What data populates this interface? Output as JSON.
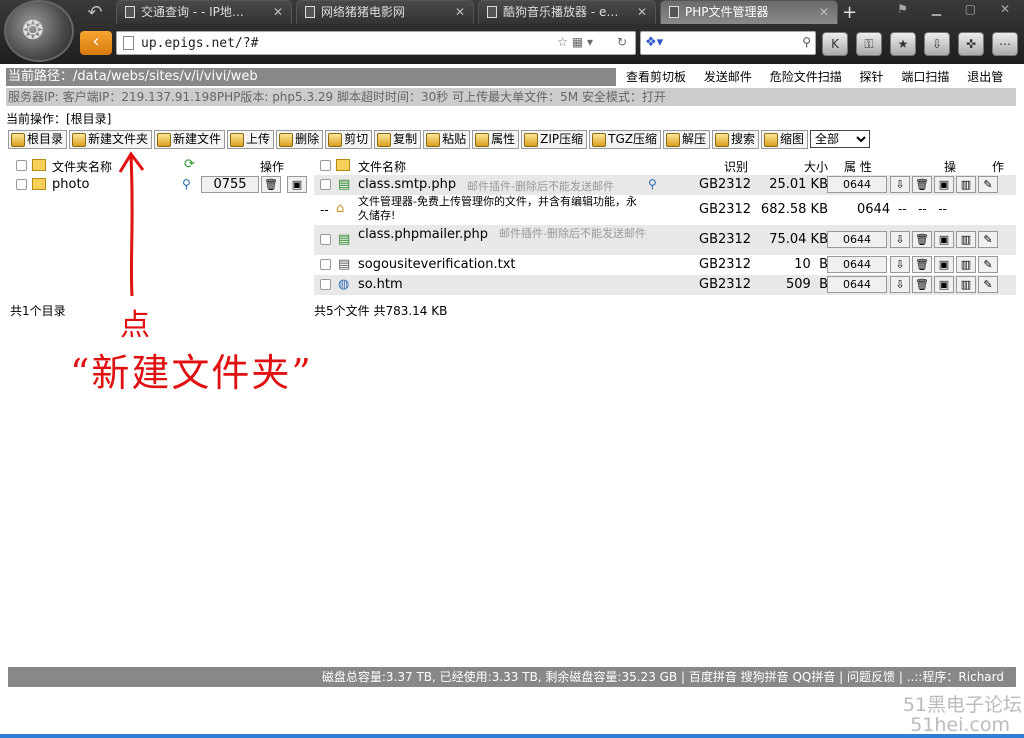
{
  "browser": {
    "tabs": [
      {
        "label": "交通查询 - - IP地…"
      },
      {
        "label": "网络猪猪电影网"
      },
      {
        "label": "酷狗音乐播放器 - e…"
      },
      {
        "label": "PHP文件管理器"
      }
    ],
    "url": "up.epigs.net/?#",
    "accent": "#f08c1c"
  },
  "path": {
    "label": "当前路径：/data/webs/sites/v/i/vivi/web"
  },
  "topmenu": [
    "查看剪切板",
    "发送邮件",
    "危险文件扫描",
    "探针",
    "端口扫描",
    "退出管理"
  ],
  "info": "服务器IP: 客户端IP：219.137.91.198PHP版本: php5.3.29 脚本超时时间：30秒 可上传最大单文件：5M 安全模式：打开",
  "current_op": "当前操作：[根目录]",
  "toolbar": {
    "items": [
      "根目录",
      "新建文件夹",
      "新建文件",
      "上传",
      "删除",
      "剪切",
      "复制",
      "粘贴",
      "属性",
      "ZIP压缩",
      "TGZ压缩",
      "解压",
      "搜索",
      "缩图"
    ],
    "select_value": "全部"
  },
  "dirs": {
    "header_name": "文件夹名称",
    "header_op": "操作",
    "rows": [
      {
        "name": "photo",
        "perm": "0755"
      }
    ],
    "count": "共1个目录"
  },
  "files": {
    "header_name": "文件名称",
    "header_enc": "识别",
    "header_size": "大小",
    "header_attr": "属 性",
    "header_op1": "操",
    "header_op2": "作",
    "rows": [
      {
        "name": "class.smtp.php",
        "desc": "邮件插件-删除后不能发送邮件",
        "enc": "GB2312",
        "size": "25.01 KB",
        "perm": "0644"
      },
      {
        "name": "文件管理器-免费上传管理你的文件，并含有编辑功能，永久储存!",
        "desc": "",
        "enc": "GB2312",
        "size": "682.58 KB",
        "perm": "0644",
        "mark": "--",
        "tail": "--   --   --"
      },
      {
        "name": "class.phpmailer.php",
        "desc": "邮件插件-删除后不能发送邮件",
        "enc": "GB2312",
        "size": "75.04 KB",
        "perm": "0644"
      },
      {
        "name": "sogousiteverification.txt",
        "desc": "",
        "enc": "GB2312",
        "size": "10  B",
        "perm": "0644"
      },
      {
        "name": "so.htm",
        "desc": "",
        "enc": "GB2312",
        "size": "509  B",
        "perm": "0644"
      }
    ],
    "count": "共5个文件 共783.14 KB"
  },
  "annotation": {
    "line1": "点",
    "line2": "“新建文件夹”",
    "color": "#e01010"
  },
  "footer": "磁盘总容量:3.37 TB, 已经使用:3.33 TB, 剩余磁盘容量:35.23 GB | 百度拼音 搜狗拼音 QQ拼音 | 问题反馈 | ..::程序：Richard",
  "watermark": {
    "line1": "51黑电子论坛",
    "line2": "51hei.com"
  }
}
